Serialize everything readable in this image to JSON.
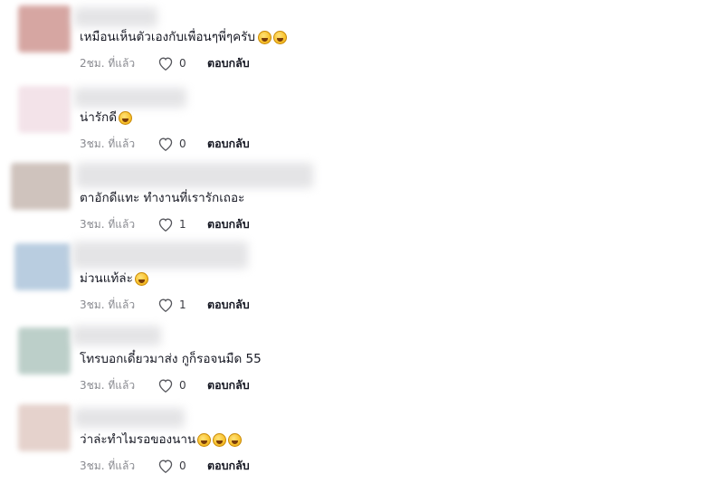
{
  "comments": [
    {
      "text": "เหมือนเห็นตัวเองกับเพื่อนๆพี่ๆครับ",
      "emojis": [
        "rofl-emoji",
        "rofl-emoji"
      ],
      "time": "2ชม. ที่แล้ว",
      "likes": "0",
      "reply": "ตอบกลับ",
      "avatar_color": "#d6a6a2"
    },
    {
      "text": "น่ารักดี",
      "emojis": [
        "grin-sweat-emoji"
      ],
      "time": "3ชม. ที่แล้ว",
      "likes": "0",
      "reply": "ตอบกลับ",
      "avatar_color": "#f3e3e9"
    },
    {
      "text": "ตาอักดีแทะ ทำงานที่เรารักเถอะ",
      "emojis": [],
      "time": "3ชม. ที่แล้ว",
      "likes": "1",
      "reply": "ตอบกลับ",
      "avatar_color": "#cfc3bd"
    },
    {
      "text": "ม่วนแท้ล่ะ",
      "emojis": [
        "grin-sweat-emoji"
      ],
      "time": "3ชม. ที่แล้ว",
      "likes": "1",
      "reply": "ตอบกลับ",
      "avatar_color": "#b9cde0"
    },
    {
      "text": "โทรบอกเดี๋ยวมาส่ง กูก็รอจนมืด 55",
      "emojis": [],
      "time": "3ชม. ที่แล้ว",
      "likes": "0",
      "reply": "ตอบกลับ",
      "avatar_color": "#bccfc9"
    },
    {
      "text": "ว่าล่ะทำไมรอของนาน",
      "emojis": [
        "grin-sweat-emoji",
        "grin-sweat-emoji",
        "grin-sweat-emoji"
      ],
      "time": "3ชม. ที่แล้ว",
      "likes": "0",
      "reply": "ตอบกลับ",
      "avatar_color": "#e5d2cc"
    }
  ]
}
